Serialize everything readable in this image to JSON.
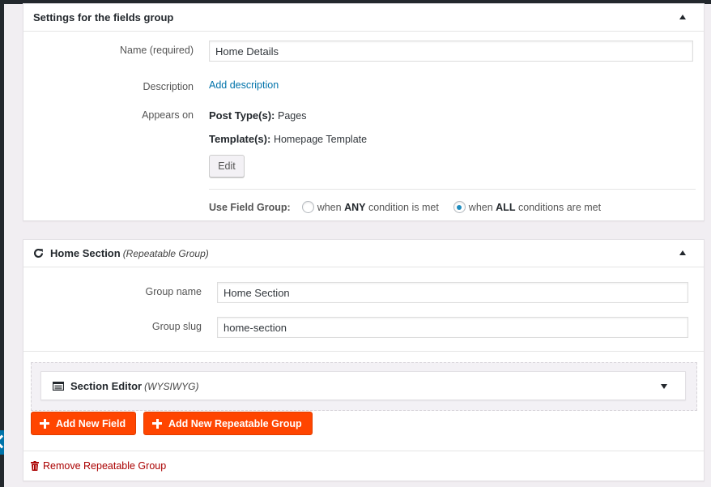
{
  "settings_box": {
    "title": "Settings for the fields group",
    "name_label": "Name (required)",
    "name_value": "Home Details",
    "description_label": "Description",
    "add_description_link": "Add description",
    "appears_on_label": "Appears on",
    "post_types_label": "Post Type(s):",
    "post_types_value": "Pages",
    "templates_label": "Template(s):",
    "templates_value": "Homepage Template",
    "edit_button": "Edit",
    "use_field_group_label": "Use Field Group:",
    "conditions": [
      {
        "prefix": "when ",
        "bold": "ANY",
        "suffix": " condition is met",
        "checked": false
      },
      {
        "prefix": "when ",
        "bold": "ALL",
        "suffix": " conditions are met",
        "checked": true
      }
    ]
  },
  "repeatable_box": {
    "title": "Home Section",
    "subtitle": "(Repeatable Group)",
    "group_name_label": "Group name",
    "group_name_value": "Home Section",
    "group_slug_label": "Group slug",
    "group_slug_value": "home-section",
    "fields": [
      {
        "title": "Section Editor",
        "type": "(WYSIWYG)",
        "icon": "wysiwyg-icon"
      }
    ],
    "add_field_button": "Add New Field",
    "add_repeatable_group_button": "Add New Repeatable Group",
    "remove_link": "Remove Repeatable Group"
  },
  "colors": {
    "accent_orange": "#ff4500",
    "link_blue": "#0073aa",
    "danger_red": "#aa0000",
    "admin_bar": "#23282d"
  }
}
